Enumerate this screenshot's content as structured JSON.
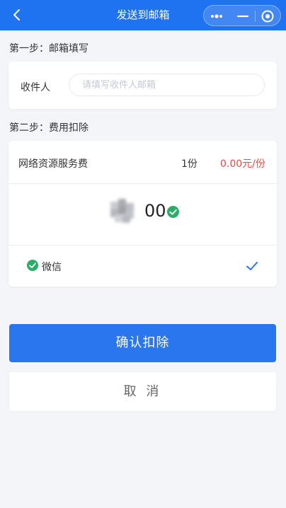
{
  "nav": {
    "title": "发送到邮箱"
  },
  "step1": {
    "title": "第一步：邮箱填写",
    "recipient_label": "收件人",
    "recipient_placeholder": "请填写收件人邮箱",
    "recipient_value": ""
  },
  "step2": {
    "title": "第二步：费用扣除",
    "fee_name": "网络资源服务费",
    "fee_qty": "1份",
    "fee_price": "0.00元/份",
    "amount_suffix": "00",
    "pay_method": "微信"
  },
  "actions": {
    "confirm": "确认扣除",
    "cancel": "取 消"
  },
  "icons": {
    "back": "back-arrow-icon",
    "more": "more-dots-icon",
    "minimize": "minimize-icon",
    "close": "close-circle-icon",
    "wechat_check": "check-circle-icon",
    "selected": "checkmark-icon"
  },
  "colors": {
    "nav_bg": "#1f72f0",
    "primary": "#2a76ef",
    "price": "#e84a45",
    "wechat_green": "#2aae67",
    "page_bg": "#f4f5f9"
  }
}
